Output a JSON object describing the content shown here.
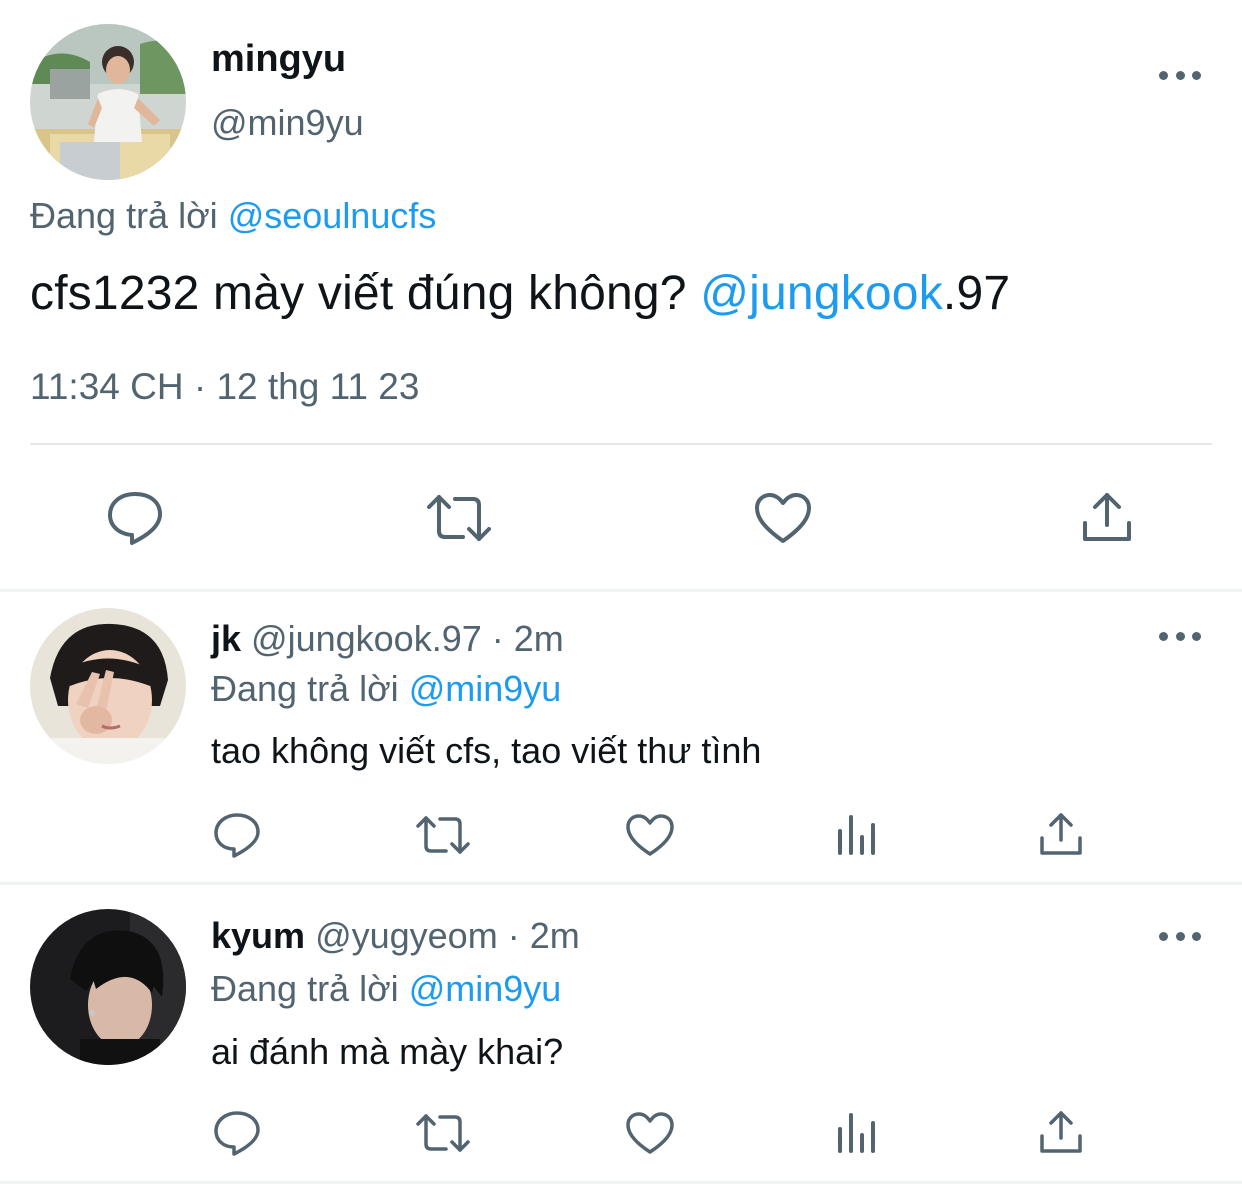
{
  "main_tweet": {
    "display_name": "mingyu",
    "handle": "@min9yu",
    "replying_to_prefix": "Đang trả lời",
    "replying_to_handle": "@seoulnucfs",
    "text_before": "cfs1232 mày viết đúng không? ",
    "mention": "@jungkook",
    "text_after": ".97",
    "timestamp": "11:34 CH · 12 thg 11 23",
    "actions": [
      "reply-icon",
      "retweet-icon",
      "like-icon",
      "share-icon"
    ]
  },
  "replies": [
    {
      "display_name": "jk",
      "handle": "@jungkook.97",
      "time": "· 2m",
      "replying_to_prefix": "Đang trả lời",
      "replying_to_handle": "@min9yu",
      "text": "tao không viết cfs, tao viết thư tình",
      "actions": [
        "reply-icon",
        "retweet-icon",
        "like-icon",
        "analytics-icon",
        "share-icon"
      ]
    },
    {
      "display_name": "kyum",
      "handle": "@yugyeom",
      "time": "· 2m",
      "replying_to_prefix": "Đang trả lời",
      "replying_to_handle": "@min9yu",
      "text": "ai đánh mà mày khai?",
      "actions": [
        "reply-icon",
        "retweet-icon",
        "like-icon",
        "analytics-icon",
        "share-icon"
      ]
    }
  ],
  "colors": {
    "text": "#0f1419",
    "muted": "#536471",
    "link": "#1d9bf0",
    "divider": "#eff3f4"
  }
}
